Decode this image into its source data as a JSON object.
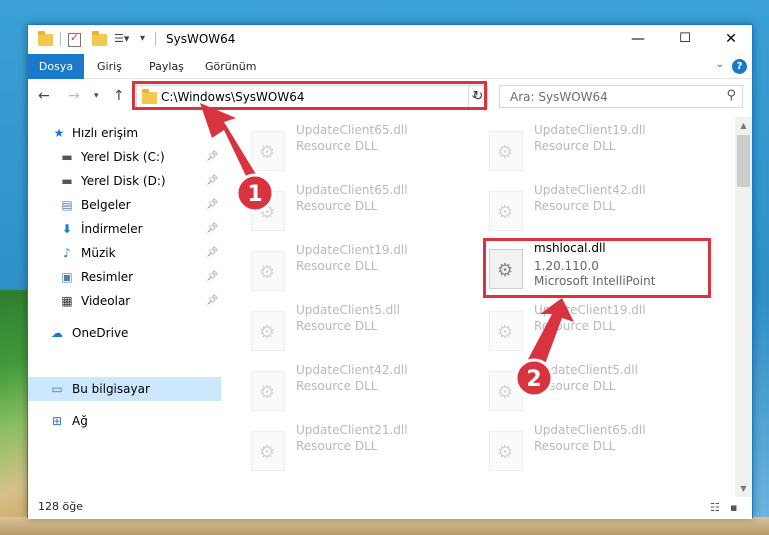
{
  "window": {
    "title": "SysWOW64"
  },
  "ribbon": {
    "tabs": [
      "Dosya",
      "Giriş",
      "Paylaş",
      "Görünüm"
    ]
  },
  "nav": {
    "address": "C:\\Windows\\SysWOW64",
    "search_placeholder": "Ara: SysWOW64"
  },
  "sidebar": {
    "quick_access": "Hızlı erişim",
    "items": [
      {
        "label": "Yerel Disk (C:)",
        "icon": "drive-icon",
        "pinned": true
      },
      {
        "label": "Yerel Disk (D:)",
        "icon": "drive-icon",
        "pinned": true
      },
      {
        "label": "Belgeler",
        "icon": "documents-icon",
        "pinned": true
      },
      {
        "label": "İndirmeler",
        "icon": "download-icon",
        "pinned": true
      },
      {
        "label": "Müzik",
        "icon": "music-icon",
        "pinned": true
      },
      {
        "label": "Resimler",
        "icon": "pictures-icon",
        "pinned": true
      },
      {
        "label": "Videolar",
        "icon": "videos-icon",
        "pinned": true
      }
    ],
    "onedrive": "OneDrive",
    "this_pc": "Bu bilgisayar",
    "network": "Ağ"
  },
  "files": {
    "left": [
      {
        "name": "UpdateClient65.dll",
        "desc": "Resource DLL"
      },
      {
        "name": "UpdateClient65.dll",
        "desc": "Resource DLL"
      },
      {
        "name": "UpdateClient19.dll",
        "desc": "Resource DLL"
      },
      {
        "name": "UpdateClient5.dll",
        "desc": "Resource DLL"
      },
      {
        "name": "UpdateClient42.dll",
        "desc": "Resource DLL"
      },
      {
        "name": "UpdateClient21.dll",
        "desc": "Resource DLL"
      }
    ],
    "right_top": [
      {
        "name": "UpdateClient19.dll",
        "desc": "Resource DLL"
      },
      {
        "name": "UpdateClient42.dll",
        "desc": "Resource DLL"
      }
    ],
    "highlight": {
      "name": "mshlocal.dll",
      "version": "1.20.110.0",
      "desc": "Microsoft IntelliPoint"
    },
    "right_bottom": [
      {
        "name": "UpdateClient19.dll",
        "desc": "Resource DLL"
      },
      {
        "name": "UpdateClient5.dll",
        "desc": "Resource DLL"
      },
      {
        "name": "UpdateClient65.dll",
        "desc": "Resource DLL"
      }
    ]
  },
  "status": {
    "count": "128 öğe"
  },
  "annotations": {
    "step1": "1",
    "step2": "2",
    "color": "#d9333f"
  },
  "colors": {
    "accent": "#1979ca",
    "selection": "#cce8ff",
    "highlight_border": "#d9333f"
  }
}
